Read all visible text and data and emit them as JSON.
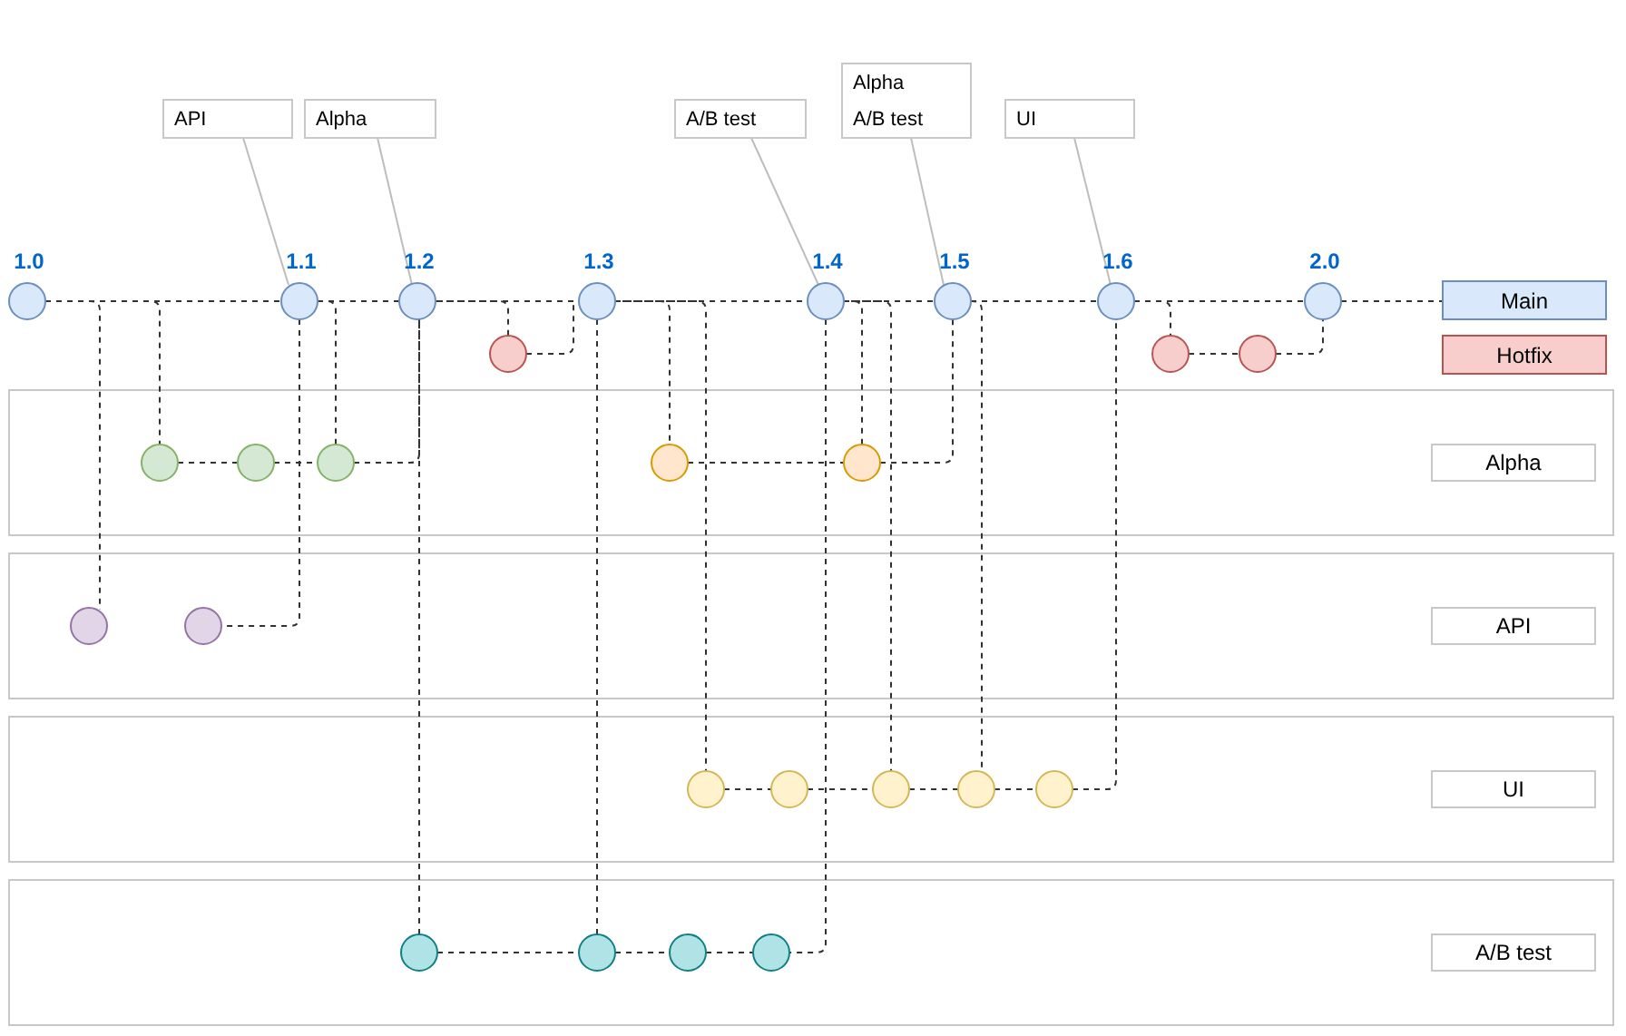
{
  "versions": [
    {
      "label": "1.0"
    },
    {
      "label": "1.1"
    },
    {
      "label": "1.2"
    },
    {
      "label": "1.3"
    },
    {
      "label": "1.4"
    },
    {
      "label": "1.5"
    },
    {
      "label": "1.6"
    },
    {
      "label": "2.0"
    }
  ],
  "callouts": [
    {
      "lines": [
        "API"
      ]
    },
    {
      "lines": [
        "Alpha"
      ]
    },
    {
      "lines": [
        "A/B test"
      ]
    },
    {
      "lines": [
        "Alpha",
        "A/B test"
      ]
    },
    {
      "lines": [
        "UI"
      ]
    }
  ],
  "legend": [
    {
      "label": "Main",
      "color": "#dae8fc"
    },
    {
      "label": "Hotfix",
      "color": "#f8cecc"
    }
  ],
  "lanes": [
    {
      "label": "Alpha",
      "color": "#d5e8d4"
    },
    {
      "label": "API",
      "color": "#e1d5e7"
    },
    {
      "label": "UI",
      "color": "#fff2cc"
    },
    {
      "label": "A/B test",
      "color": "#b0e3e6"
    }
  ]
}
